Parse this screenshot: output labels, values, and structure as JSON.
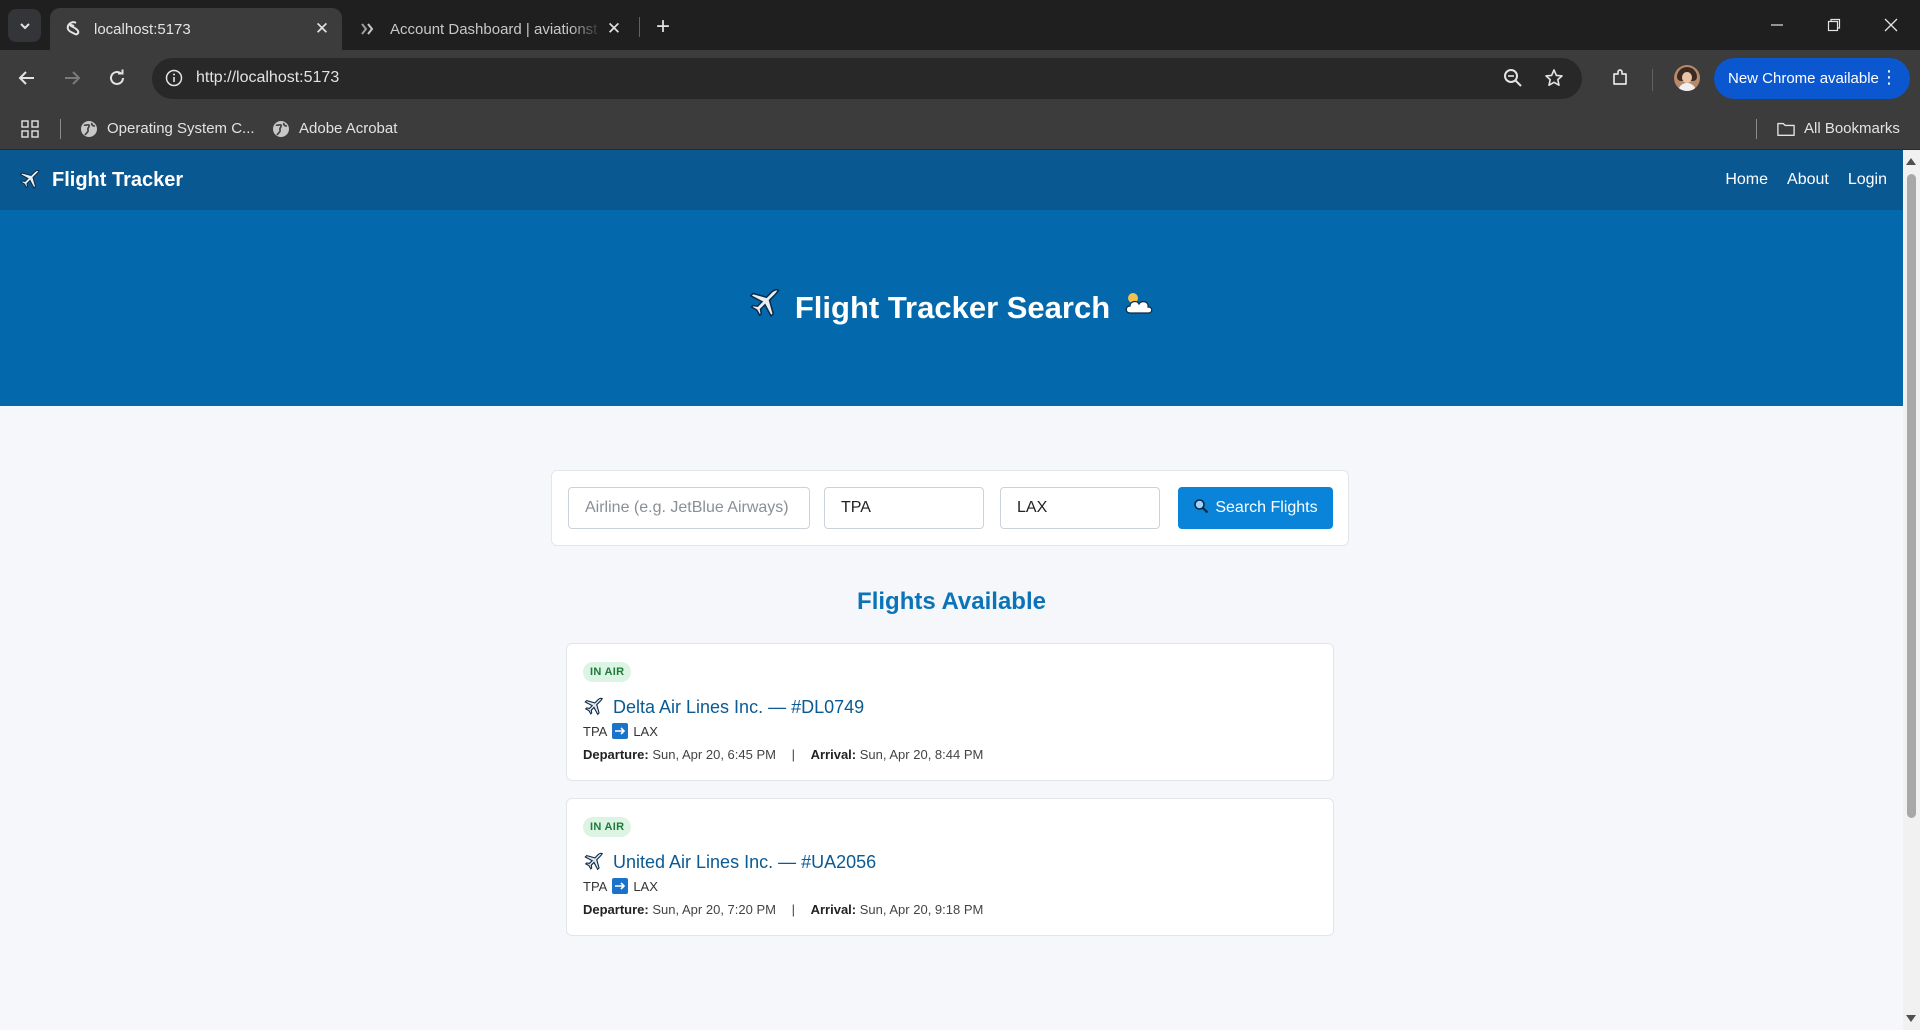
{
  "browser": {
    "tabs": [
      {
        "title": "localhost:5173",
        "active": true
      },
      {
        "title": "Account Dashboard | aviationst",
        "active": false
      }
    ],
    "url": "http://localhost:5173",
    "update_label": "New Chrome available",
    "bookmarks": [
      {
        "label": "Operating System C..."
      },
      {
        "label": "Adobe Acrobat"
      }
    ],
    "all_bookmarks_label": "All Bookmarks"
  },
  "app": {
    "brand": "Flight Tracker",
    "nav": {
      "home": "Home",
      "about": "About",
      "login": "Login"
    },
    "hero_title": "Flight Tracker Search",
    "search": {
      "airline_placeholder": "Airline (e.g. JetBlue Airways)",
      "airline_value": "",
      "origin_value": "TPA",
      "destination_value": "LAX",
      "button_label": "Search Flights"
    },
    "results_title": "Flights Available",
    "flights": [
      {
        "status": "IN AIR",
        "title": "Delta Air Lines Inc. — #DL0749",
        "origin": "TPA",
        "destination": "LAX",
        "departure_label": "Departure:",
        "departure": "Sun, Apr 20, 6:45 PM",
        "arrival_label": "Arrival:",
        "arrival": "Sun, Apr 20, 8:44 PM"
      },
      {
        "status": "IN AIR",
        "title": "United Air Lines Inc. — #UA2056",
        "origin": "TPA",
        "destination": "LAX",
        "departure_label": "Departure:",
        "departure": "Sun, Apr 20, 7:20 PM",
        "arrival_label": "Arrival:",
        "arrival": "Sun, Apr 20, 9:18 PM"
      }
    ]
  },
  "colors": {
    "nav_bg": "#0a5892",
    "hero_bg": "#0368ac",
    "accent": "#0a84d9",
    "status_in_air_bg": "#dcf4e3",
    "status_in_air_text": "#1f7a3a"
  }
}
